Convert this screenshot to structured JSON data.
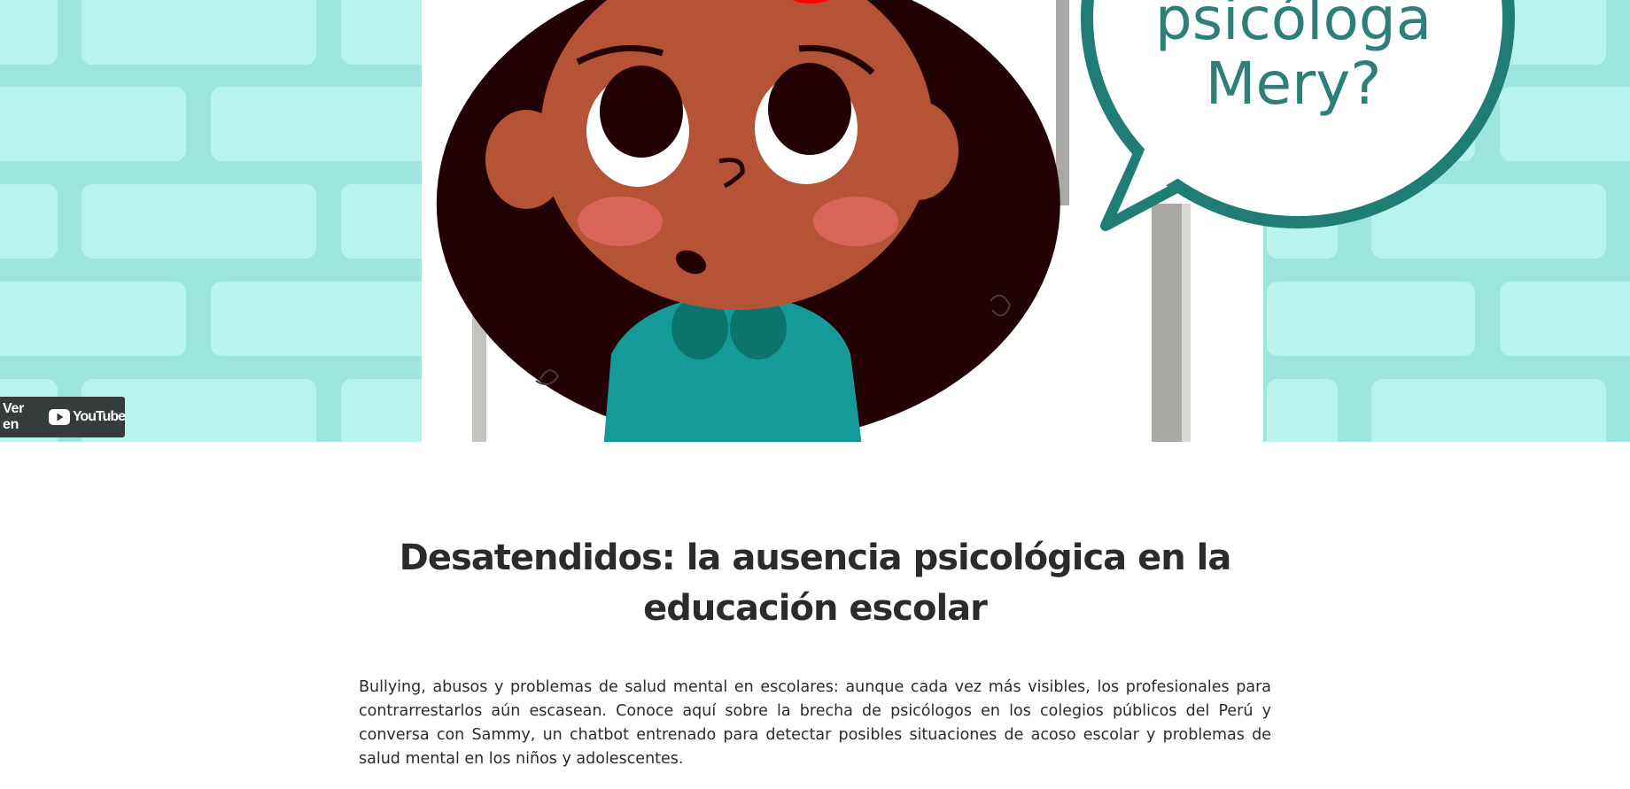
{
  "video": {
    "speech_bubble": {
      "line1": "psicóloga",
      "line2": "Mery?"
    },
    "youtube_badge": {
      "label": "Ver en",
      "brand": "YouTube"
    }
  },
  "article": {
    "title": "Desatendidos: la ausencia psicológica en la educación escolar",
    "lead": "Bullying, abusos y problemas de salud mental en escolares: aunque cada vez más visibles, los profesionales para contrarrestarlos aún escasean. Conoce aquí sobre la brecha de psicólogos en los colegios públicos del Perú y conversa con Sammy, un chatbot entrenado para detectar posibles situaciones de acoso escolar y problemas de salud mental en los niños y adolescentes."
  },
  "colors": {
    "wall_background": "#bff4ef",
    "brick": "#b9f3ee",
    "mortar": "#9ee5de",
    "skin": "#b45336",
    "hair": "#230205",
    "shirt": "#159a9a",
    "bubble_border": "#1f7d73",
    "badge": "#363c3b",
    "youtube_red": "#ff0000",
    "title_text": "#2b2b2b"
  }
}
